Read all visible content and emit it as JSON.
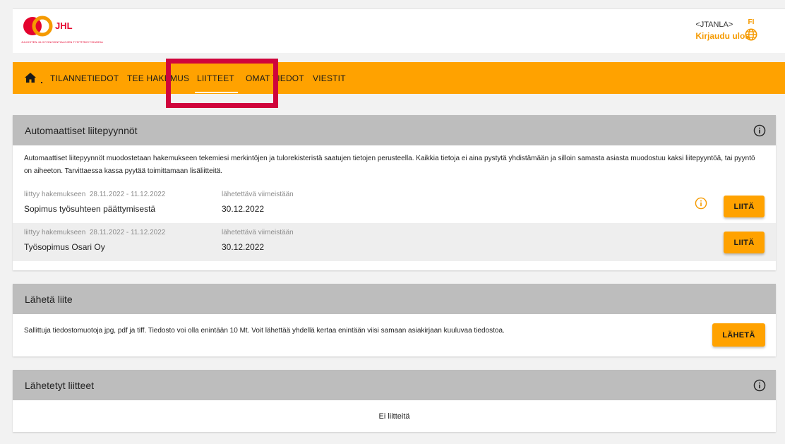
{
  "header": {
    "logo_text": "JHL",
    "logo_tagline": "JULKISTEN JA HYVINVOINTIALOJEN TYÖTTÖMYYSKASSA",
    "username": "<JTANLA>",
    "logout_label": "Kirjaudu ulos",
    "language": "FI",
    "icons": {
      "home": "home-icon",
      "language": "globe-icon"
    }
  },
  "nav": {
    "items": [
      {
        "label": "TILANNETIEDOT"
      },
      {
        "label": "TEE HAKEMUS"
      },
      {
        "label": "LIITTEET",
        "active": true
      },
      {
        "label": "OMAT TIEDOT"
      },
      {
        "label": "VIESTIT"
      }
    ]
  },
  "auto_requests": {
    "title": "Automaattiset liitepyynnöt",
    "description": "Automaattiset liitepyynnöt muodostetaan hakemukseen tekemiesi merkintöjen ja tulorekisteristä saatujen tietojen perusteella. Kaikkia tietoja ei aina pystytä yhdistämään ja silloin samasta asiasta muodostuu kaksi liitepyyntöä, tai pyyntö on aiheeton. Tarvittaessa kassa pyytää toimittamaan lisäliitteitä.",
    "items": [
      {
        "related_label": "liittyy hakemukseen",
        "period": "28.11.2022 - 11.12.2022",
        "name": "Sopimus työsuhteen päättymisestä",
        "due_label": "lähetettävä viimeistään",
        "due": "30.12.2022",
        "warning": true,
        "button": "LIITÄ"
      },
      {
        "related_label": "liittyy hakemukseen",
        "period": "28.11.2022 - 11.12.2022",
        "name": "Työsopimus Osari Oy",
        "due_label": "lähetettävä viimeistään",
        "due": "30.12.2022",
        "warning": false,
        "button": "LIITÄ"
      }
    ]
  },
  "send": {
    "title": "Lähetä liite",
    "description": "Sallittuja tiedostomuotoja jpg, pdf ja tiff. Tiedosto voi olla enintään 10 Mt. Voit lähettää yhdellä kertaa enintään viisi samaan asiakirjaan kuuluvaa tiedostoa.",
    "button": "LÄHETÄ"
  },
  "sent": {
    "title": "Lähetetyt liitteet",
    "empty_text": "Ei liitteitä"
  },
  "colors": {
    "accent": "#ffa200",
    "link": "#f59a00",
    "brand_red": "#e4032e",
    "highlight": "#d0043c",
    "section_header": "#bdbdbd"
  }
}
